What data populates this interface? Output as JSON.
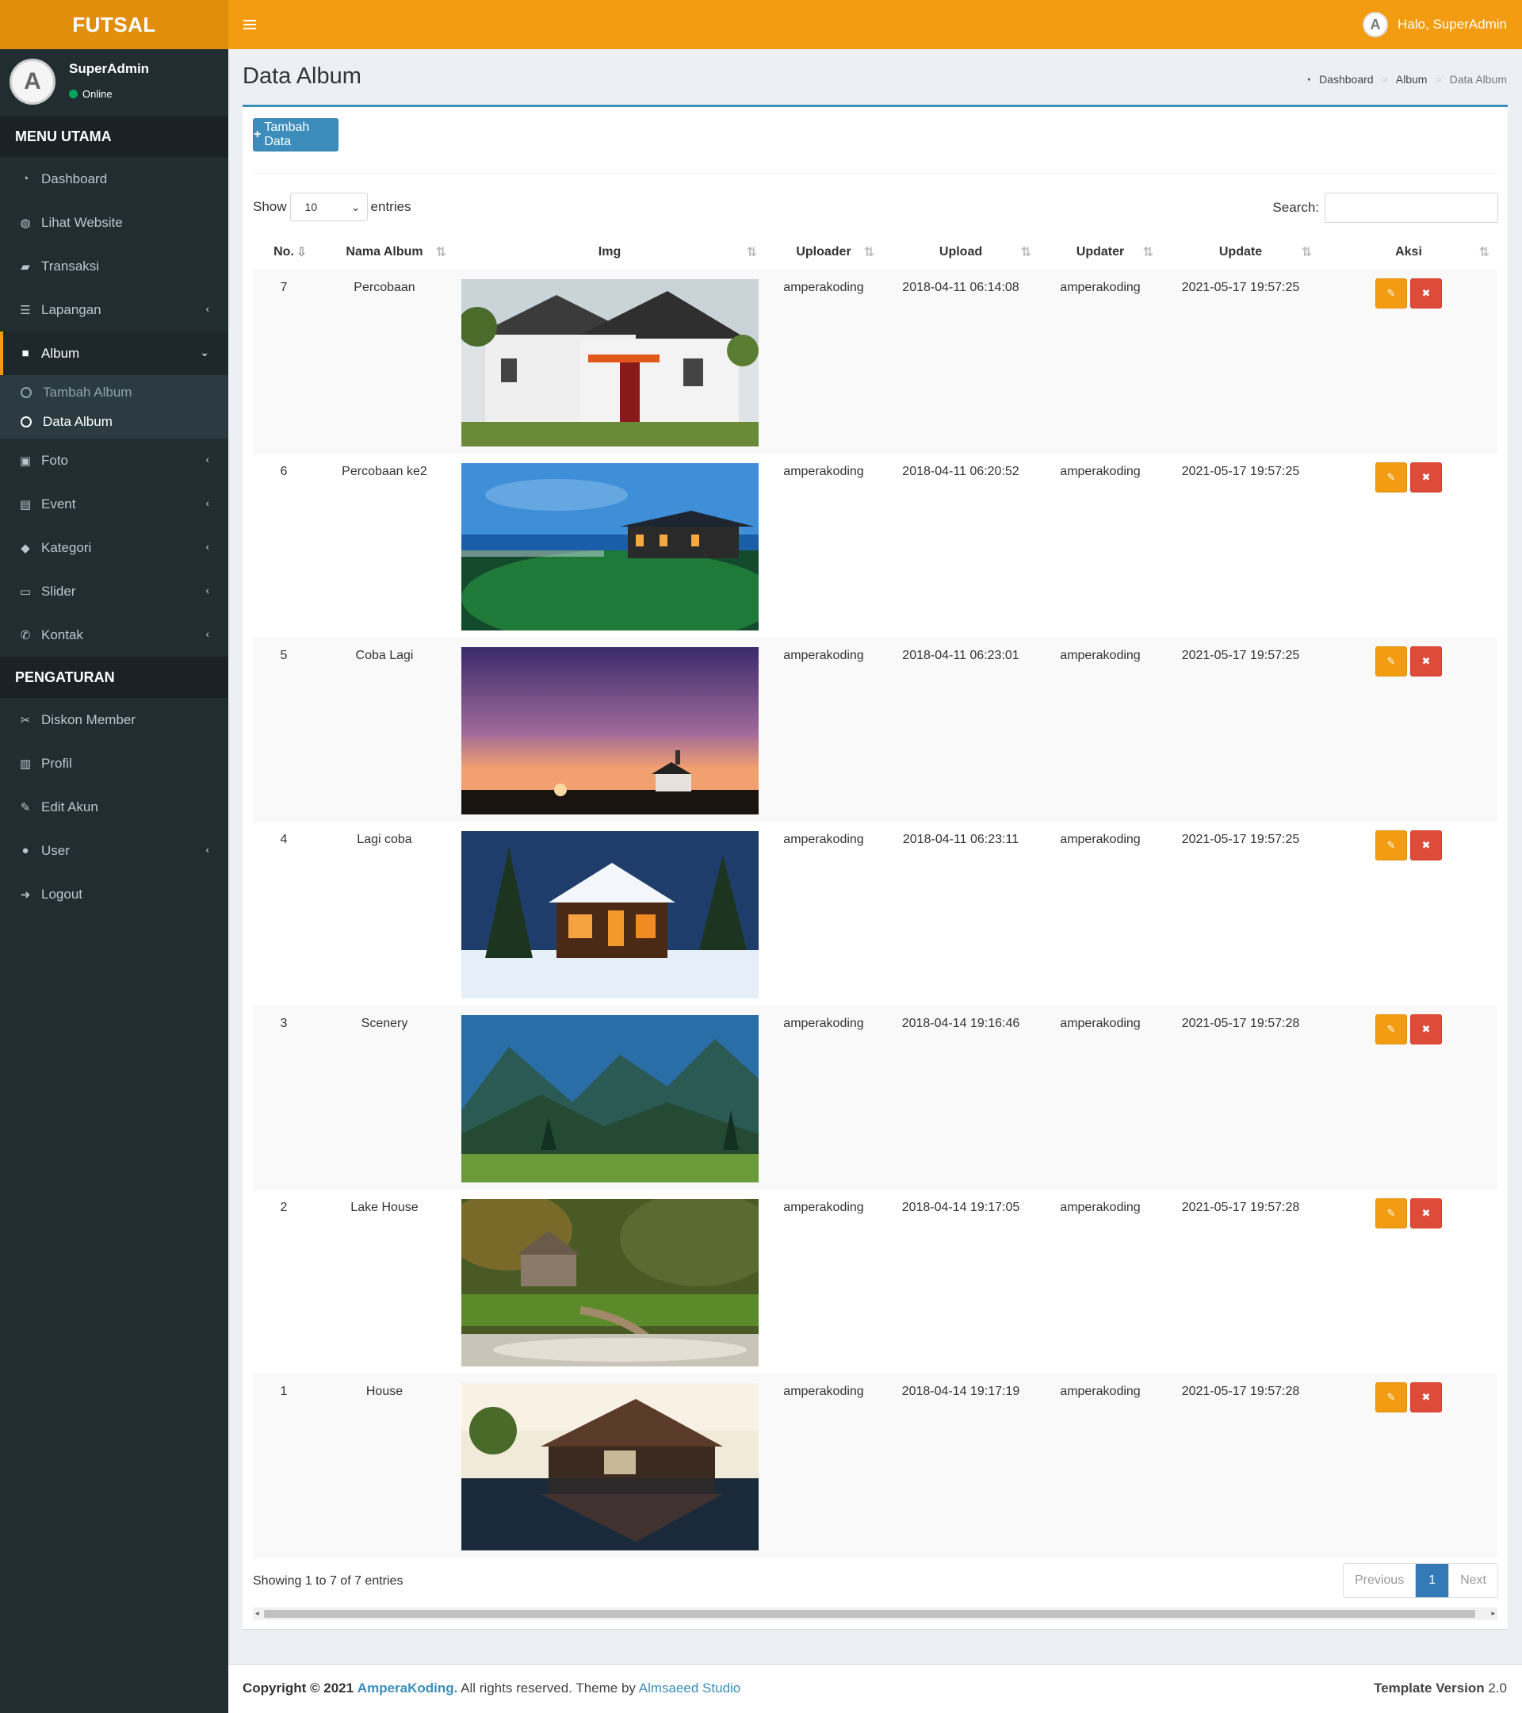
{
  "app": {
    "logo": "FUTSAL",
    "greeting": "Halo, SuperAdmin"
  },
  "user": {
    "name": "SuperAdmin",
    "status": "Online"
  },
  "sidebar": {
    "main_header": "MENU UTAMA",
    "main_items": [
      {
        "label": "Dashboard",
        "icon": "dashboard-icon"
      },
      {
        "label": "Lihat Website",
        "icon": "globe-icon"
      },
      {
        "label": "Transaksi",
        "icon": "book-icon"
      },
      {
        "label": "Lapangan",
        "icon": "list-icon"
      },
      {
        "label": "Album",
        "icon": "folder-icon"
      },
      {
        "label": "Foto",
        "icon": "image-icon"
      },
      {
        "label": "Event",
        "icon": "newspaper-icon"
      },
      {
        "label": "Kategori",
        "icon": "tag-icon"
      },
      {
        "label": "Slider",
        "icon": "credit-card-icon"
      },
      {
        "label": "Kontak",
        "icon": "phone-icon"
      }
    ],
    "album_sub": [
      "Tambah Album",
      "Data Album"
    ],
    "settings_header": "PENGATURAN",
    "settings_items": [
      {
        "label": "Diskon Member",
        "icon": "scissors-icon"
      },
      {
        "label": "Profil",
        "icon": "building-icon"
      },
      {
        "label": "Edit Akun",
        "icon": "edit-icon"
      },
      {
        "label": "User",
        "icon": "user-icon"
      },
      {
        "label": "Logout",
        "icon": "sign-out-icon"
      }
    ]
  },
  "page": {
    "title": "Data Album",
    "breadcrumb": [
      "Dashboard",
      "Album",
      "Data Album"
    ],
    "add_button": "Tambah Data",
    "show_label": "Show",
    "entries_label": "entries",
    "page_length": "10",
    "search_label": "Search:"
  },
  "table": {
    "headers": [
      "No.",
      "Nama Album",
      "Img",
      "Uploader",
      "Upload",
      "Updater",
      "Update",
      "Aksi"
    ],
    "rows": [
      {
        "no": "7",
        "name": "Percobaan",
        "img": "house-modern",
        "uploader": "amperakoding",
        "upload": "2018-04-11 06:14:08",
        "updater": "amperakoding",
        "update": "2021-05-17 19:57:25"
      },
      {
        "no": "6",
        "name": "Percobaan ke2",
        "img": "pagoda-night",
        "uploader": "amperakoding",
        "upload": "2018-04-11 06:20:52",
        "updater": "amperakoding",
        "update": "2021-05-17 19:57:25"
      },
      {
        "no": "5",
        "name": "Coba Lagi",
        "img": "chapel-dusk",
        "uploader": "amperakoding",
        "upload": "2018-04-11 06:23:01",
        "updater": "amperakoding",
        "update": "2021-05-17 19:57:25"
      },
      {
        "no": "4",
        "name": "Lagi coba",
        "img": "snow-cabin",
        "uploader": "amperakoding",
        "upload": "2018-04-11 06:23:11",
        "updater": "amperakoding",
        "update": "2021-05-17 19:57:25"
      },
      {
        "no": "3",
        "name": "Scenery",
        "img": "mountain-valley",
        "uploader": "amperakoding",
        "upload": "2018-04-14 19:16:46",
        "updater": "amperakoding",
        "update": "2021-05-17 19:57:28"
      },
      {
        "no": "2",
        "name": "Lake House",
        "img": "forest-cottage",
        "uploader": "amperakoding",
        "upload": "2018-04-14 19:17:05",
        "updater": "amperakoding",
        "update": "2021-05-17 19:57:28"
      },
      {
        "no": "1",
        "name": "House",
        "img": "lake-villa",
        "uploader": "amperakoding",
        "upload": "2018-04-14 19:17:19",
        "updater": "amperakoding",
        "update": "2021-05-17 19:57:28"
      }
    ],
    "info": "Showing 1 to 7 of 7 entries",
    "pagination": {
      "prev": "Previous",
      "page": "1",
      "next": "Next"
    }
  },
  "footer": {
    "copyright": "Copyright © 2021",
    "brand": "AmperaKoding.",
    "rights": "All rights reserved. Theme by",
    "theme": "Almsaeed Studio",
    "version_label": "Template Version",
    "version": "2.0"
  },
  "colors": {
    "header": "#f39c12",
    "sidebar": "#222d32",
    "primary": "#3c8dbc",
    "danger": "#dd4b39"
  }
}
